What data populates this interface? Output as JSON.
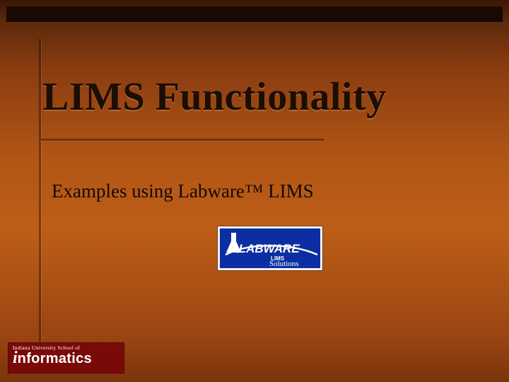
{
  "slide": {
    "title": "LIMS Functionality",
    "subtitle": "Examples using Labware™ LIMS"
  },
  "labware_logo": {
    "name": "LABWARE",
    "tagline_top": "LIMS",
    "tagline_bottom": "Solutions"
  },
  "iu_logo": {
    "school_line": "Indiana University School of",
    "word_first": "i",
    "word_rest": "nformatics"
  },
  "colors": {
    "slide_bg_mid": "#b25616",
    "labware_blue": "#0b2ea2",
    "iu_red": "#7a0a0a"
  }
}
